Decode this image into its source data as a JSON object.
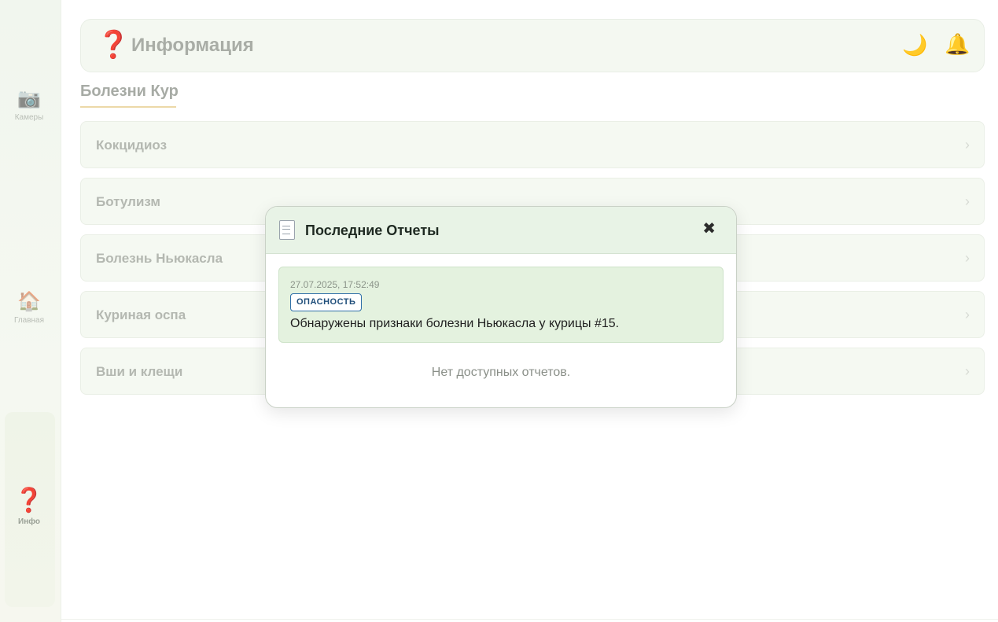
{
  "sidebar": {
    "items": [
      {
        "label": "Камеры",
        "icon": "camera-icon",
        "glyph": "📷"
      },
      {
        "label": "Главная",
        "icon": "home-icon",
        "glyph": "🏠"
      },
      {
        "label": "Инфо",
        "icon": "question-icon",
        "glyph": "❓",
        "active": true
      }
    ]
  },
  "header": {
    "icon_glyph": "❓",
    "title": "Информация",
    "moon_glyph": "🌙",
    "bell_glyph": "🔔"
  },
  "section": {
    "title": "Болезни Кур"
  },
  "diseases": [
    {
      "label": "Кокцидиоз",
      "chevron": "›"
    },
    {
      "label": "Ботулизм",
      "chevron": "›"
    },
    {
      "label": "Болезнь Ньюкасла",
      "chevron": "›"
    },
    {
      "label": "Куриная оспа",
      "chevron": "›"
    },
    {
      "label": "Вши и клещи",
      "chevron": "›"
    }
  ],
  "modal": {
    "title": "Последние Отчеты",
    "close_glyph": "✖",
    "reports": [
      {
        "timestamp": "27.07.2025, 17:52:49",
        "badge": "ОПАСНОСТЬ",
        "message": "Обнаружены признаки болезни Ньюкасла у курицы #15."
      }
    ],
    "empty_text": "Нет доступных отчетов."
  },
  "colors": {
    "badge_border": "#2f6fa8",
    "report_bg": "#e4f2df",
    "modal_header_bg": "#e8f3e6",
    "accent_underline": "#ecd9a8"
  }
}
